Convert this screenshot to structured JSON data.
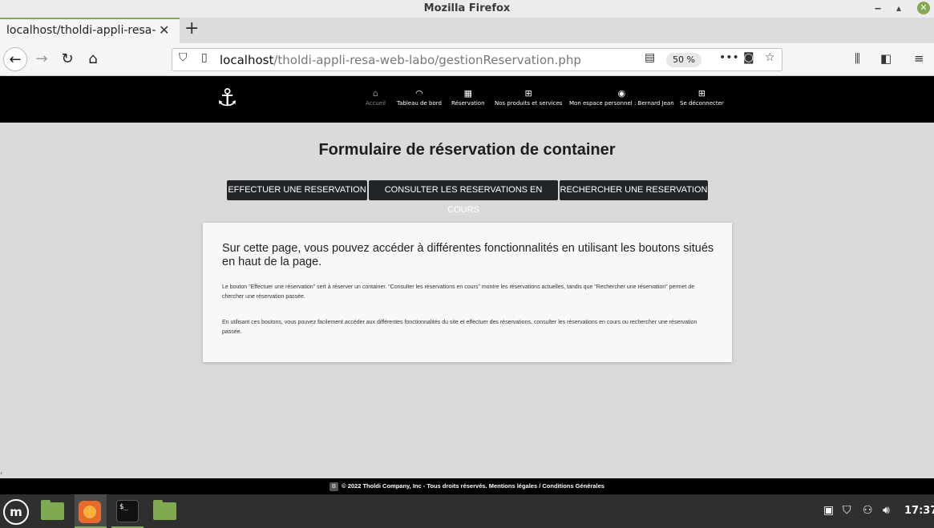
{
  "window": {
    "title": "Mozilla Firefox"
  },
  "browser": {
    "tab_title": "localhost/tholdi-appli-resa-web",
    "url_host": "localhost",
    "url_path": "/tholdi-appli-resa-web-labo/gestionReservation.php",
    "zoom": "50 %"
  },
  "site": {
    "logo": "⚓",
    "nav": [
      {
        "icon": "home-icon",
        "label": "Accueil"
      },
      {
        "icon": "dashboard-icon",
        "label": "Tableau de bord"
      },
      {
        "icon": "calendar-icon",
        "label": "Réservation"
      },
      {
        "icon": "grid-icon",
        "label": "Nos produits et services"
      },
      {
        "icon": "user-icon",
        "label": "Mon espace personnel : Bernard Jean"
      },
      {
        "icon": "grid-icon",
        "label": "Se déconnecter"
      }
    ]
  },
  "main": {
    "title": "Formulaire de réservation de container",
    "buttons": [
      "EFFECTUER UNE RESERVATION",
      "CONSULTER LES RESERVATIONS EN COURS",
      "RECHERCHER UNE RESERVATION"
    ],
    "card": {
      "lead": "Sur cette page, vous pouvez accéder à différentes fonctionnalités en utilisant les boutons situés en haut de la page.",
      "p1": "Le bouton \"Effectuer une réservation\" sert à réserver un container. \"Consulter les réservations en cours\" montre les réservations actuelles, tandis que \"Rechercher une réservation\" permet de chercher une réservation passée.",
      "p2": "En utilisant ces boutons, vous pouvez facilement accéder aux différentes fonctionnalités du site et effectuer des réservations, consulter les réservations en cours ou rechercher une réservation passée."
    }
  },
  "footer": {
    "badge": "B",
    "text": "© 2022 Tholdi Company, Inc - Tous droits réservés. Mentions légales / Conditions Générales"
  },
  "taskbar": {
    "clock": "17:37"
  }
}
